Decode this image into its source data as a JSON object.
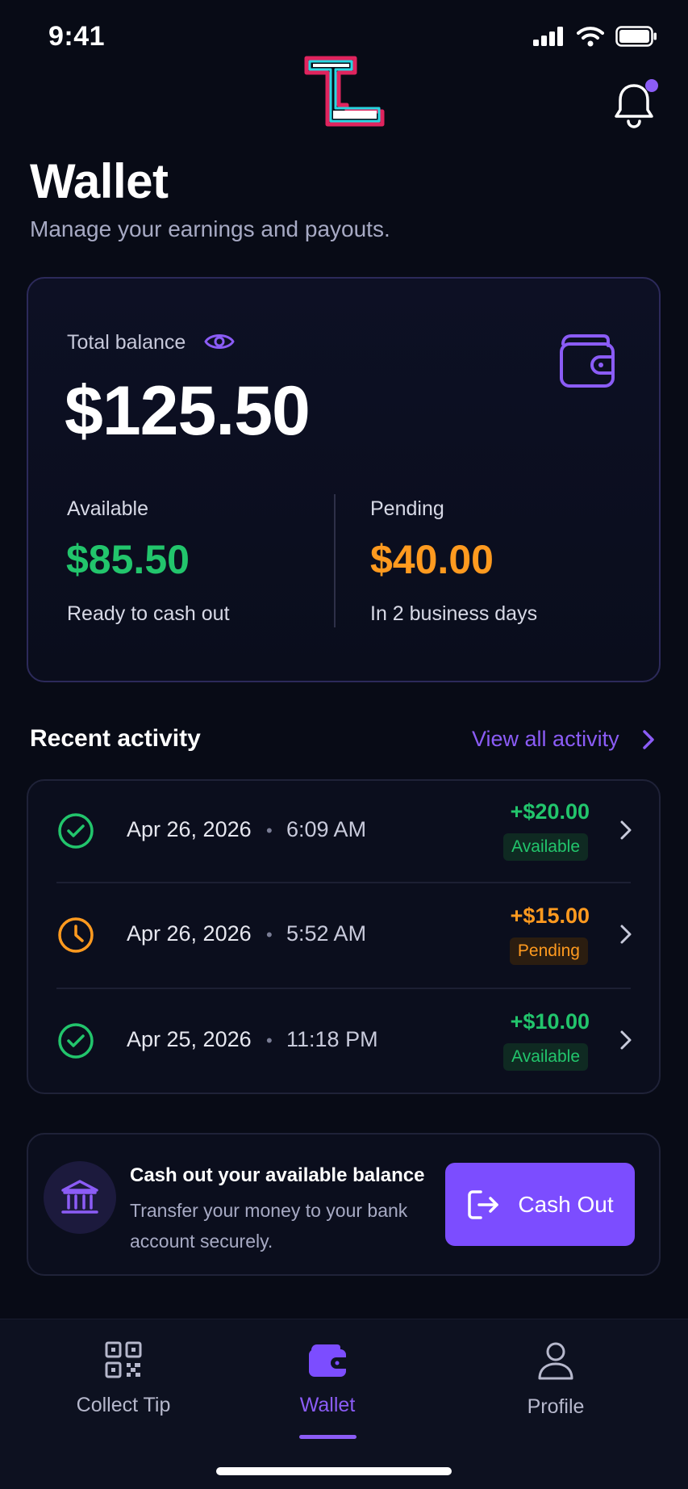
{
  "status_bar": {
    "time": "9:41"
  },
  "header": {
    "title": "Wallet",
    "subtitle": "Manage your earnings and payouts."
  },
  "balance": {
    "label": "Total balance",
    "total": "$125.50",
    "available": {
      "label": "Available",
      "value": "$85.50",
      "note": "Ready to cash out"
    },
    "pending": {
      "label": "Pending",
      "value": "$40.00",
      "note": "In 2 business days"
    }
  },
  "activity": {
    "title": "Recent activity",
    "view_all": "View all activity",
    "items": [
      {
        "date": "Apr 26, 2026",
        "separator": "•",
        "time": "6:09 AM",
        "amount": "+$20.00",
        "status": "Available",
        "icon": "check-circle-icon"
      },
      {
        "date": "Apr 26, 2026",
        "separator": "•",
        "time": "5:52 AM",
        "amount": "+$15.00",
        "status": "Pending",
        "icon": "clock-icon"
      },
      {
        "date": "Apr 25, 2026",
        "separator": "•",
        "time": "11:18 PM",
        "amount": "+$10.00",
        "status": "Available",
        "icon": "check-circle-icon"
      }
    ]
  },
  "cashout": {
    "title": "Cash out your available balance",
    "description": "Transfer your money to your bank account securely.",
    "button": "Cash Out"
  },
  "nav": {
    "items": [
      {
        "label": "Collect Tip",
        "icon": "qr-code-icon"
      },
      {
        "label": "Wallet",
        "icon": "wallet-icon",
        "active": true
      },
      {
        "label": "Profile",
        "icon": "user-icon"
      }
    ]
  },
  "colors": {
    "accent": "#8b5cf6",
    "available": "#22c56c",
    "pending": "#ff9a1f",
    "background": "#080b16"
  }
}
